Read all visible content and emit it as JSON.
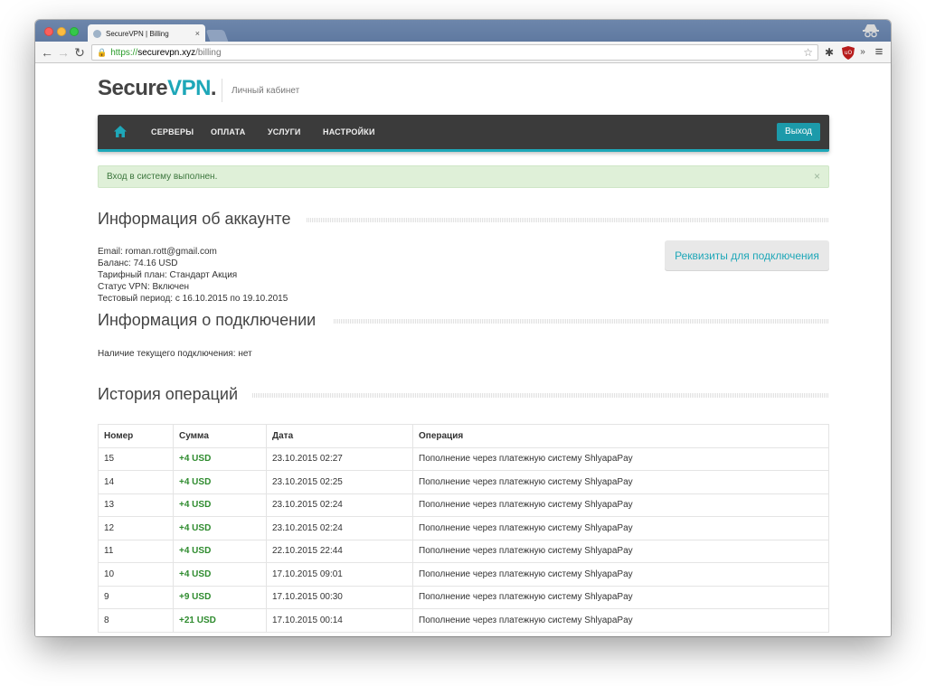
{
  "browser": {
    "tab_title": "SecureVPN | Billing",
    "tab_close": "×",
    "url_scheme": "https://",
    "url_host": "securevpn.xyz",
    "url_path": "/billing",
    "nav_back": "←",
    "nav_forward": "→",
    "nav_reload": "↻",
    "star": "☆",
    "settings_glyph": "✱",
    "overflow_glyph": "»",
    "menu_glyph": "≡"
  },
  "header": {
    "logo_part1": "Secure",
    "logo_part2": "VPN",
    "logo_part3": ".",
    "subtitle": "Личный кабинет"
  },
  "nav": {
    "items": [
      "СЕРВЕРЫ",
      "ОПЛАТА",
      "УСЛУГИ",
      "НАСТРОЙКИ"
    ],
    "logout": "Выход"
  },
  "alert": {
    "text": "Вход в систему выполнен.",
    "close": "×"
  },
  "account": {
    "title": "Информация об аккаунте",
    "email": "Email: roman.rott@gmail.com",
    "balance": "Баланс: 74.16 USD",
    "plan": "Тарифный план: Стандарт Акция",
    "vpn_status": "Статус VPN: Включен",
    "trial": "Тестовый период: с 16.10.2015 по 19.10.2015",
    "details_button": "Реквизиты для подключения"
  },
  "connection": {
    "title": "Информация о подключении",
    "current": "Наличие текущего подключения: нет"
  },
  "history": {
    "title": "История операций",
    "headers": [
      "Номер",
      "Сумма",
      "Дата",
      "Операция"
    ],
    "rows": [
      [
        "15",
        "+4 USD",
        "23.10.2015 02:27",
        "Пополнение через платежную систему ShlyapaPay"
      ],
      [
        "14",
        "+4 USD",
        "23.10.2015 02:25",
        "Пополнение через платежную систему ShlyapaPay"
      ],
      [
        "13",
        "+4 USD",
        "23.10.2015 02:24",
        "Пополнение через платежную систему ShlyapaPay"
      ],
      [
        "12",
        "+4 USD",
        "23.10.2015 02:24",
        "Пополнение через платежную систему ShlyapaPay"
      ],
      [
        "11",
        "+4 USD",
        "22.10.2015 22:44",
        "Пополнение через платежную систему ShlyapaPay"
      ],
      [
        "10",
        "+4 USD",
        "17.10.2015 09:01",
        "Пополнение через платежную систему ShlyapaPay"
      ],
      [
        "9",
        "+9 USD",
        "17.10.2015 00:30",
        "Пополнение через платежную систему ShlyapaPay"
      ],
      [
        "8",
        "+21 USD",
        "17.10.2015 00:14",
        "Пополнение через платежную систему ShlyapaPay"
      ]
    ]
  },
  "colors": {
    "accent": "#1ea7b8",
    "nav_bg": "#3b3b3b",
    "amount": "#2e8b2e",
    "alert_bg": "#dff0d8"
  },
  "icons": {
    "home": "home-icon",
    "lock": "lock-icon",
    "star": "star-icon",
    "settings": "gear-icon",
    "extension": "ublock-icon",
    "menu": "hamburger-menu-icon",
    "incognito": "incognito-icon"
  }
}
